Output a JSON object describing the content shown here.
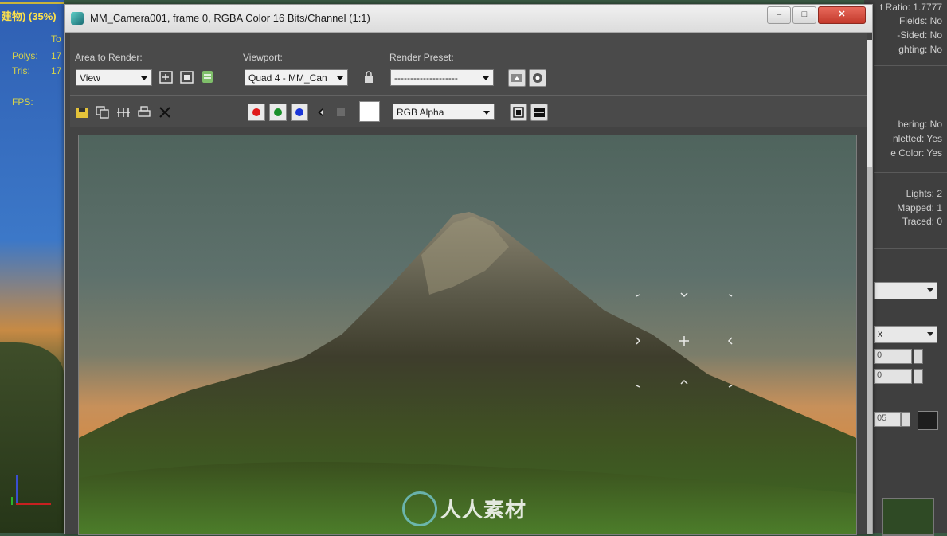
{
  "background": {
    "viewport_title": "建物) (35%)",
    "stats": [
      {
        "label": "To",
        "value": ""
      },
      {
        "label": "Polys:",
        "value": "17"
      },
      {
        "label": "Tris:",
        "value": "17"
      },
      {
        "label": "FPS:",
        "value": ""
      }
    ],
    "right_panel": {
      "render_info": [
        "t Ratio: 1.7777",
        "Fields: No",
        "-Sided: No",
        "ghting: No"
      ],
      "render_info_2": [
        "bering: No",
        "nletted: Yes",
        "e Color: Yes"
      ],
      "render_info_3": [
        "Lights: 2",
        "Mapped: 1",
        "Traced: 0"
      ],
      "dropdown_2_value": "x",
      "spinner_1": "0",
      "spinner_2": "0",
      "spinner_3": "05"
    }
  },
  "dialog": {
    "title": "MM_Camera001, frame 0, RGBA Color 16 Bits/Channel (1:1)",
    "window_buttons": [
      "–",
      "□",
      "✕"
    ],
    "toolbar": {
      "area_label": "Area to Render:",
      "area_value": "View",
      "viewport_label": "Viewport:",
      "viewport_value": "Quad 4 - MM_Can",
      "preset_label": "Render Preset:",
      "preset_value": "--------------------",
      "channel_value": "RGB Alpha"
    },
    "channel_colors": {
      "red": "#e01a1a",
      "green": "#1a8f2a",
      "blue": "#1a35d8"
    }
  },
  "watermark": "人人素材"
}
